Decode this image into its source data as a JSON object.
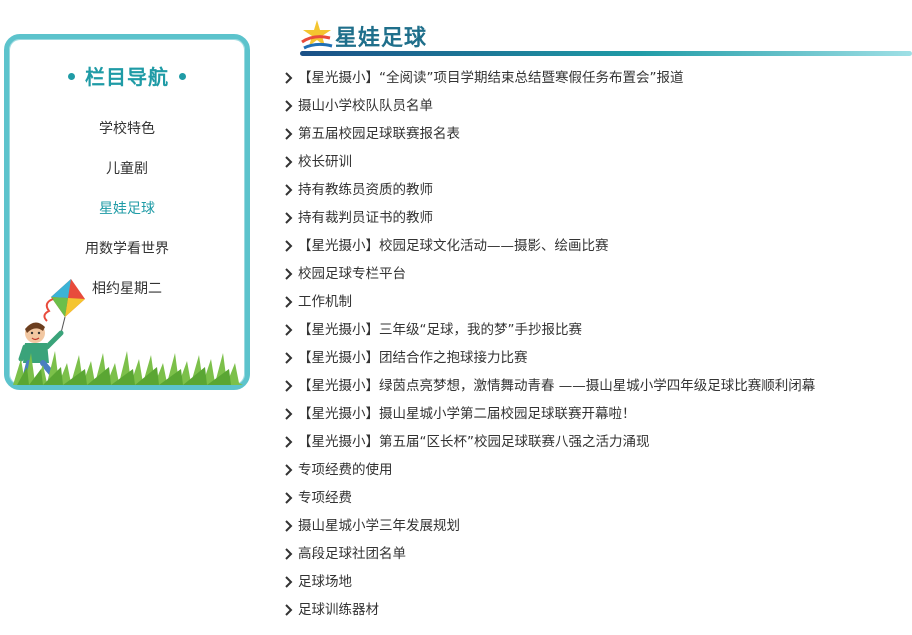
{
  "sidebar": {
    "title": "栏目导航",
    "items": [
      {
        "label": "学校特色",
        "active": false
      },
      {
        "label": "儿童剧",
        "active": false
      },
      {
        "label": "星娃足球",
        "active": true
      },
      {
        "label": "用数学看世界",
        "active": false
      },
      {
        "label": "相约星期二",
        "active": false
      }
    ]
  },
  "header": {
    "title": "星娃足球"
  },
  "articles": [
    "【星光摄小】“全阅读”项目学期结束总结暨寒假任务布置会”报道",
    "摄山小学校队队员名单",
    "第五届校园足球联赛报名表",
    "校长研训",
    "持有教练员资质的教师",
    "持有裁判员证书的教师",
    "【星光摄小】校园足球文化活动——摄影、绘画比赛",
    "校园足球专栏平台",
    "工作机制",
    "【星光摄小】三年级“足球，我的梦”手抄报比赛",
    "【星光摄小】团结合作之抱球接力比赛",
    "【星光摄小】绿茵点亮梦想，激情舞动青春 ——摄山星城小学四年级足球比赛顺利闭幕",
    "【星光摄小】摄山星城小学第二届校园足球联赛开幕啦！",
    "【星光摄小】第五届“区长杯”校园足球联赛八强之活力涌现",
    "专项经费的使用",
    "专项经费",
    "摄山星城小学三年发展规划",
    "高段足球社团名单",
    "足球场地",
    "足球训练器材"
  ],
  "colors": {
    "accent": "#1f9ba6",
    "border": "#5cc3cc",
    "heading": "#1f6f8b"
  }
}
